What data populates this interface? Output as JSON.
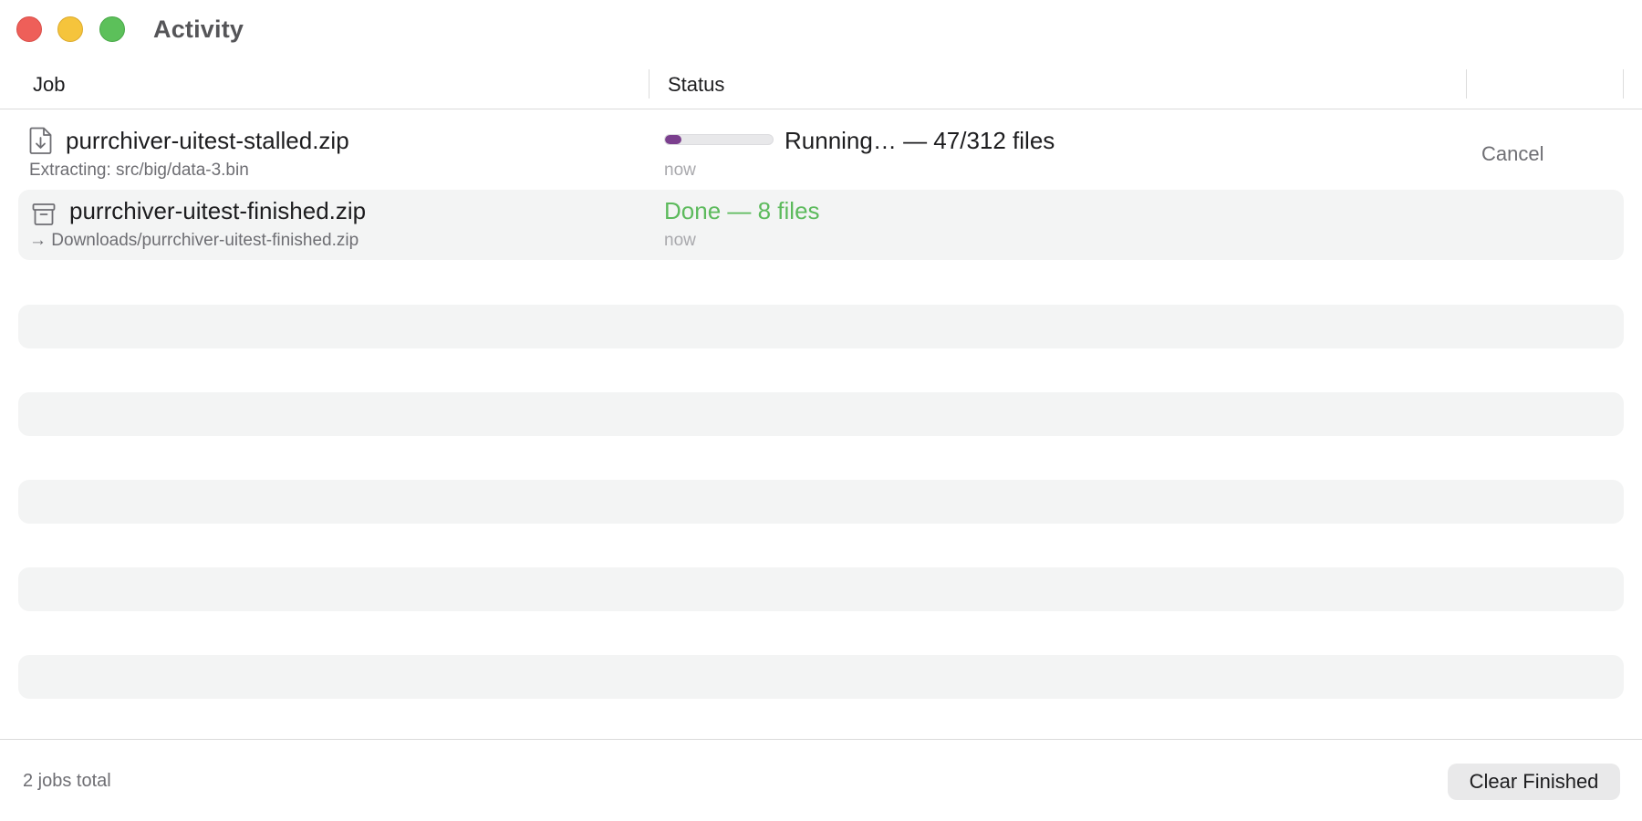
{
  "window": {
    "title": "Activity"
  },
  "columns": {
    "job": "Job",
    "status": "Status"
  },
  "jobs": [
    {
      "name": "purrchiver-uitest-stalled.zip",
      "detail": "Extracting: src/big/data-3.bin",
      "icon": "document-download-icon",
      "progress": 0.15,
      "progress_color": "#7b3f8e",
      "status": "Running… — 47/312 files",
      "status_color": "#1d1d1f",
      "time": "now",
      "action": "Cancel"
    },
    {
      "name": "purrchiver-uitest-finished.zip",
      "detail": "→ Downloads/purrchiver-uitest-finished.zip",
      "icon": "archive-box-icon",
      "status": "Done — 8 files",
      "status_color": "#5cba5c",
      "time": "now"
    }
  ],
  "footer": {
    "count": "2 jobs total",
    "clear_label": "Clear Finished"
  }
}
